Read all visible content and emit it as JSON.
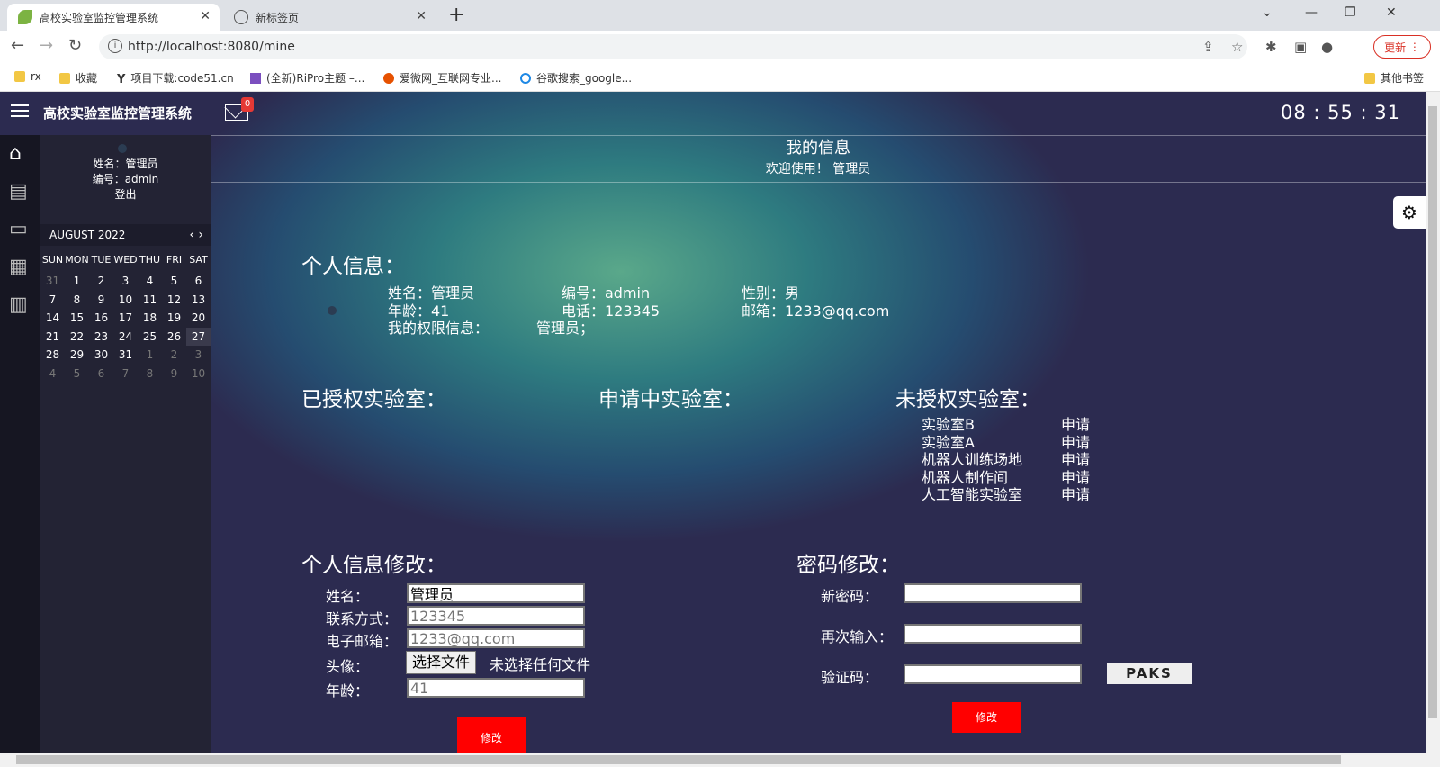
{
  "browser": {
    "tabs": [
      {
        "title": "高校实验室监控管理系统",
        "active": true
      },
      {
        "title": "新标签页",
        "active": false
      }
    ],
    "url": "http://localhost:8080/mine",
    "update_label": "更新",
    "bookmarks": [
      "rx",
      "收藏",
      "项目下载:code51.cn",
      "(全新)RiPro主题 –...",
      "爱微网_互联网专业...",
      "谷歌搜索_google..."
    ],
    "other_bookmarks": "其他书签"
  },
  "app": {
    "brand": "高校实验室监控管理系统",
    "mail_count": "0",
    "clock": "08 : 55 : 31",
    "user": {
      "name_line": "姓名：管理员",
      "id_line": "编号：admin",
      "logout": "登出"
    },
    "calendar": {
      "month": "AUGUST 2022",
      "dow": [
        "SUN",
        "MON",
        "TUE",
        "WED",
        "THU",
        "FRI",
        "SAT"
      ],
      "weeks": [
        [
          "31",
          "1",
          "2",
          "3",
          "4",
          "5",
          "6"
        ],
        [
          "7",
          "8",
          "9",
          "10",
          "11",
          "12",
          "13"
        ],
        [
          "14",
          "15",
          "16",
          "17",
          "18",
          "19",
          "20"
        ],
        [
          "21",
          "22",
          "23",
          "24",
          "25",
          "26",
          "27"
        ],
        [
          "28",
          "29",
          "30",
          "31",
          "1",
          "2",
          "3"
        ],
        [
          "4",
          "5",
          "6",
          "7",
          "8",
          "9",
          "10"
        ]
      ]
    },
    "header": {
      "title": "我的信息",
      "welcome": "欢迎使用！ 管理员"
    },
    "info": {
      "section": "个人信息：",
      "name": "姓名：管理员",
      "id": "编号：admin",
      "gender": "性别：男",
      "age": "年龄：41",
      "phone": "电话：123345",
      "email": "邮箱：1233@qq.com",
      "perm_label": "我的权限信息：",
      "perm_value": "管理员；"
    },
    "labs": {
      "authorized": "已授权实验室：",
      "pending": "申请中实验室：",
      "unauthorized": "未授权实验室：",
      "apply_label": "申请",
      "list": [
        "实验室B",
        "实验室A",
        "机器人训练场地",
        "机器人制作间",
        "人工智能实验室"
      ]
    },
    "edit": {
      "section": "个人信息修改：",
      "name_label": "姓名：",
      "name_value": "管理员",
      "phone_label": "联系方式：",
      "phone_placeholder": "123345",
      "email_label": "电子邮箱：",
      "email_placeholder": "1233@qq.com",
      "avatar_label": "头像：",
      "file_button": "选择文件",
      "file_status": "未选择任何文件",
      "age_label": "年龄：",
      "age_placeholder": "41",
      "submit": "修改"
    },
    "password": {
      "section": "密码修改：",
      "new_label": "新密码：",
      "repeat_label": "再次输入：",
      "captcha_label": "验证码：",
      "captcha_text": "PAKS",
      "submit": "修改"
    }
  }
}
